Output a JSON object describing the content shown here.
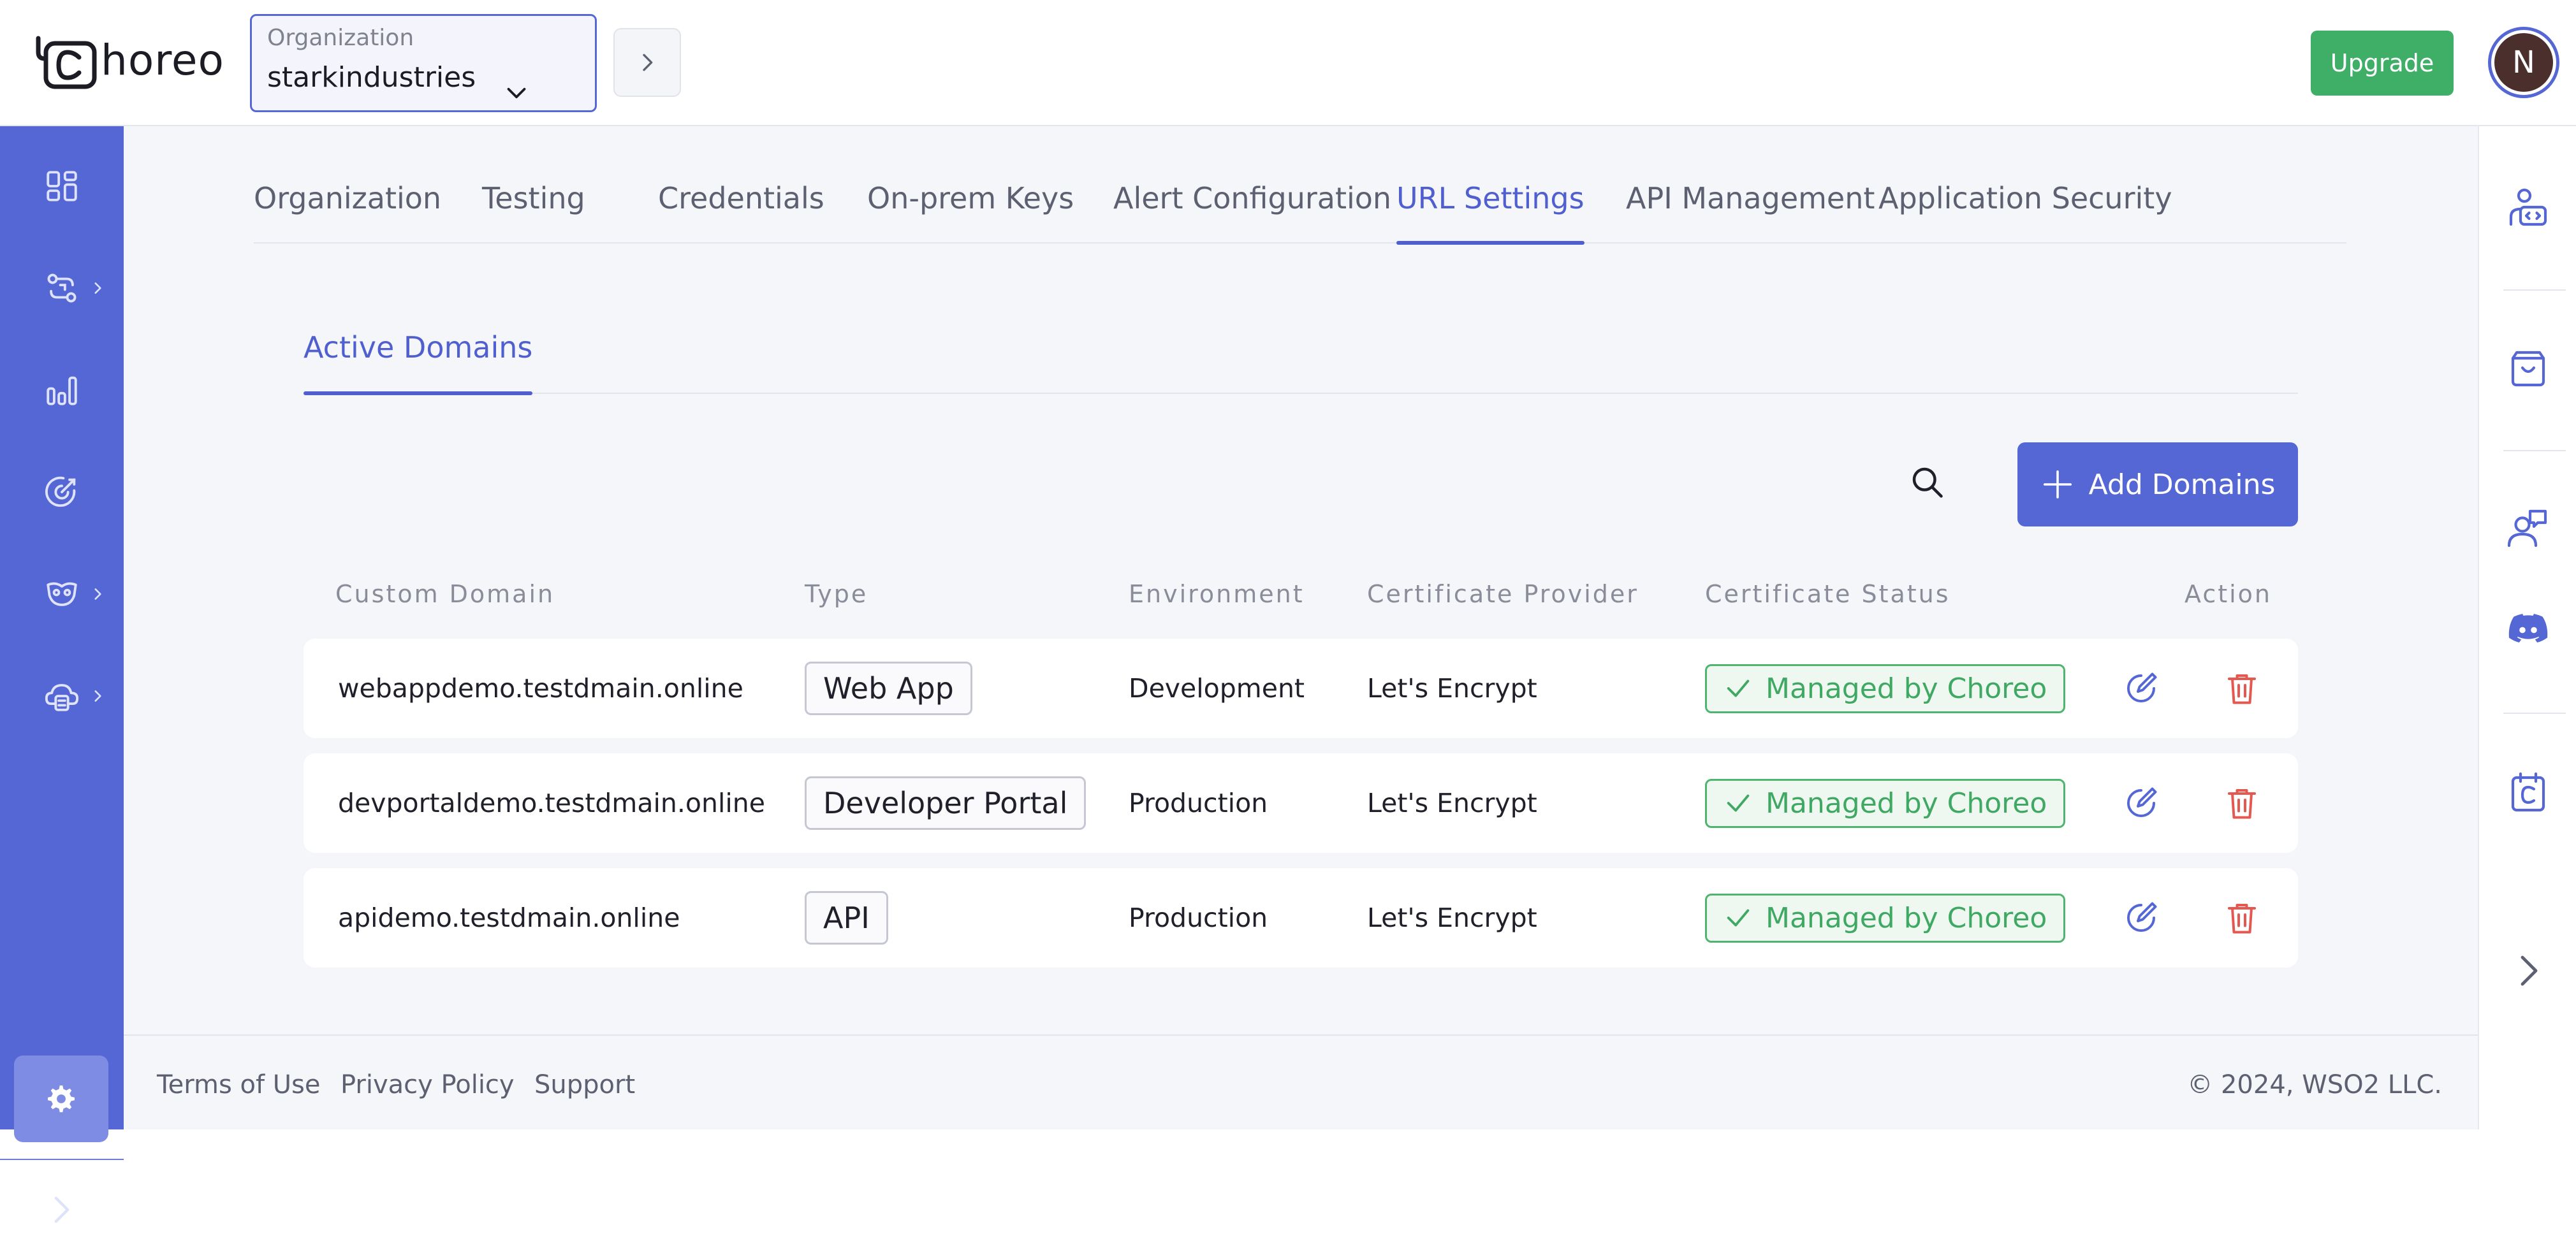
{
  "brand": {
    "logo_text": "horeo",
    "accent": "#5567d5",
    "success": "#3fae67",
    "danger": "#e5584f"
  },
  "header": {
    "org_label": "Organization",
    "org_value": "starkindustries",
    "upgrade_label": "Upgrade",
    "avatar_initial": "N"
  },
  "sidebar": {
    "items": [
      {
        "icon": "grid-icon"
      },
      {
        "icon": "integrations-icon"
      },
      {
        "icon": "analytics-icon"
      },
      {
        "icon": "target-icon"
      },
      {
        "icon": "mask-icon"
      },
      {
        "icon": "cloud-deploy-icon"
      }
    ],
    "settings_icon": "gear-icon",
    "expand_icon": "chevron-right-icon"
  },
  "right_rail": {
    "icons": [
      "user-code-icon",
      "marketplace-icon",
      "support-chat-icon",
      "discord-icon",
      "choreo-docs-icon",
      "chevron-right-icon"
    ]
  },
  "main_tabs": [
    {
      "label": "Organization"
    },
    {
      "label": "Testing"
    },
    {
      "label": "Credentials"
    },
    {
      "label": "On-prem Keys"
    },
    {
      "label": "Alert Configuration"
    },
    {
      "label": "URL Settings",
      "active": true
    },
    {
      "label": "API Management"
    },
    {
      "label": "Application Security"
    }
  ],
  "sub_tabs": {
    "active": "Active Domains"
  },
  "toolbar": {
    "add_domains_label": "Add Domains"
  },
  "table": {
    "headers": [
      "Custom Domain",
      "Type",
      "Environment",
      "Certificate Provider",
      "Certificate Status",
      "Action"
    ],
    "rows": [
      {
        "domain": "webappdemo.testdmain.online",
        "type": "Web App",
        "environment": "Development",
        "provider": "Let's Encrypt",
        "status": "Managed by Choreo"
      },
      {
        "domain": "devportaldemo.testdmain.online",
        "type": "Developer Portal",
        "environment": "Production",
        "provider": "Let's Encrypt",
        "status": "Managed by Choreo"
      },
      {
        "domain": "apidemo.testdmain.online",
        "type": "API",
        "environment": "Production",
        "provider": "Let's Encrypt",
        "status": "Managed by Choreo"
      }
    ]
  },
  "footer": {
    "links": [
      "Terms of Use",
      "Privacy Policy",
      "Support"
    ],
    "copyright": "© 2024, WSO2 LLC."
  }
}
